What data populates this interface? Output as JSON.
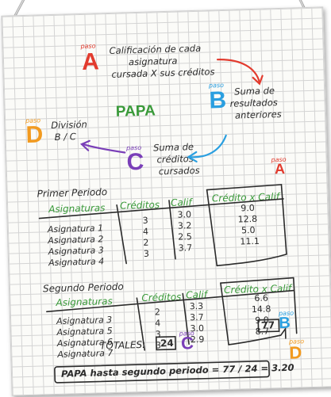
{
  "colors": {
    "red": "#e23b2e",
    "blue": "#2a9fe0",
    "purple": "#7a3fb8",
    "orange": "#f29a1f",
    "green": "#3a9a3a",
    "ink": "#2b2b2b"
  },
  "steps": {
    "a": {
      "paso": "paso",
      "letter": "A",
      "text": [
        "Calificación de cada",
        "asignatura",
        "cursada X sus créditos"
      ]
    },
    "b": {
      "paso": "paso",
      "letter": "B",
      "text": [
        "Suma de",
        "resultados",
        "anteriores"
      ]
    },
    "c": {
      "paso": "paso",
      "letter": "C",
      "text": [
        "Suma de",
        "créditos",
        "cursados"
      ]
    },
    "d": {
      "paso": "paso",
      "letter": "D",
      "text": [
        "División",
        "B / C"
      ]
    }
  },
  "center_title": "PAPA",
  "period1": {
    "title": "Primer Periodo",
    "headers": [
      "Asignaturas",
      "Créditos",
      "Calif",
      "Crédito x Calif"
    ],
    "tag_paso": "paso",
    "tag_letter": "A",
    "rows": [
      [
        "Asignatura 1",
        "3",
        "3.0",
        "9.0"
      ],
      [
        "Asignatura 2",
        "4",
        "3.2",
        "12.8"
      ],
      [
        "Asignatura 3",
        "2",
        "2.5",
        "5.0"
      ],
      [
        "Asignatura 4",
        "3",
        "3.7",
        "11.1"
      ]
    ]
  },
  "period2": {
    "title": "Segundo Periodo",
    "headers": [
      "Asignaturas",
      "Créditos",
      "Calif",
      "Crédito x Calif"
    ],
    "rows": [
      [
        "Asignatura 3",
        "2",
        "3.3",
        "6.6"
      ],
      [
        "Asignatura 5",
        "4",
        "3.7",
        "14.8"
      ],
      [
        "Asignatura 6",
        "3",
        "3.0",
        "9.0"
      ],
      [
        "Asignatura 7",
        "3",
        "2.9",
        "8.7"
      ]
    ]
  },
  "totals": {
    "label": "TOTALES:",
    "credits": "24",
    "credits_paso": "paso",
    "credits_letter": "C",
    "sum": "77",
    "sum_paso": "paso",
    "sum_letter": "B"
  },
  "result": {
    "text": "PAPA hasta segundo periodo = 77 / 24 = 3.20",
    "paso": "paso",
    "letter": "D"
  }
}
